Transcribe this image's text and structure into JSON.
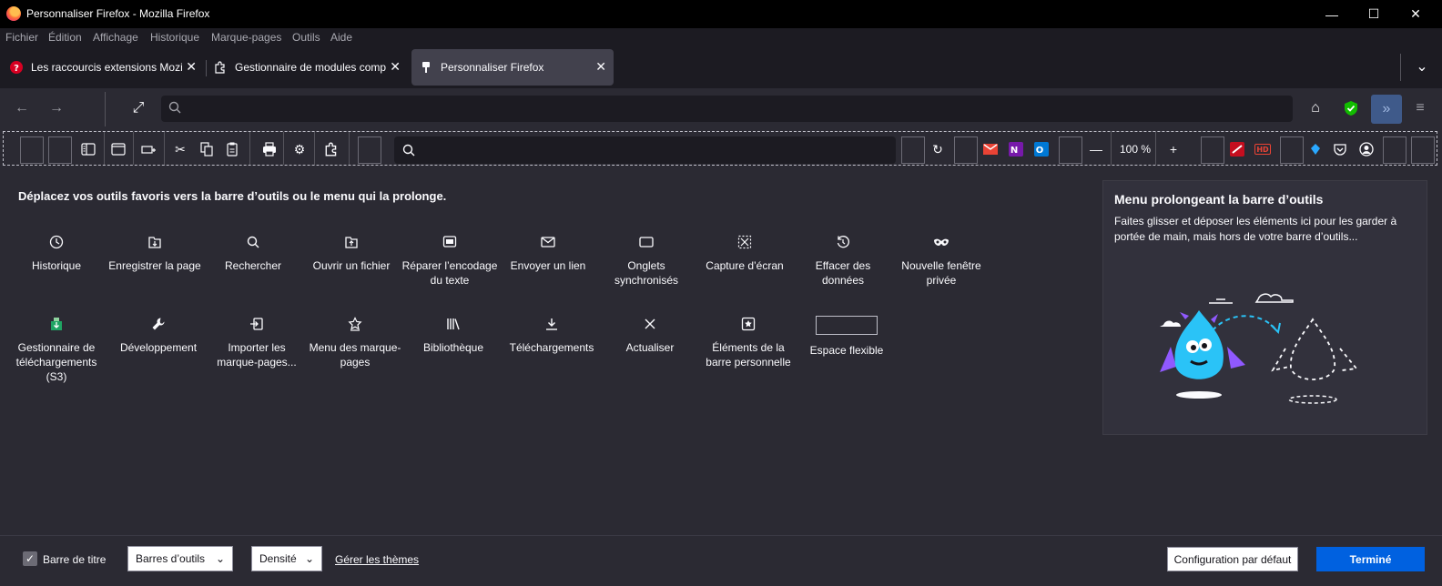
{
  "window": {
    "title": "Personnaliser Firefox - Mozilla Firefox"
  },
  "menubar": [
    "Fichier",
    "Édition",
    "Affichage",
    "Historique",
    "Marque-pages",
    "Outils",
    "Aide"
  ],
  "tabs": [
    {
      "label": "Les raccourcis extensions Mozilla",
      "active": false
    },
    {
      "label": "Gestionnaire de modules complémentaires",
      "active": false
    },
    {
      "label": "Personnaliser Firefox",
      "active": true
    }
  ],
  "custom_toolbar": {
    "zoom": "100 %"
  },
  "instruction": "Déplacez vos outils favoris vers la barre d’outils ou le menu qui la prolonge.",
  "palette_row1": [
    {
      "label": "Historique",
      "icon": "history-icon"
    },
    {
      "label": "Enregistrer la page",
      "icon": "save-page-icon"
    },
    {
      "label": "Rechercher",
      "icon": "search-icon"
    },
    {
      "label": "Ouvrir un fichier",
      "icon": "open-file-icon"
    },
    {
      "label": "Réparer l’encodage du texte",
      "icon": "text-encoding-icon"
    },
    {
      "label": "Envoyer un lien",
      "icon": "email-link-icon"
    },
    {
      "label": "Onglets synchronisés",
      "icon": "synced-tabs-icon"
    },
    {
      "label": "Capture d’écran",
      "icon": "screenshot-icon"
    },
    {
      "label": "Effacer des données",
      "icon": "forget-icon"
    },
    {
      "label": "Nouvelle fenêtre privée",
      "icon": "private-window-icon"
    }
  ],
  "palette_row2": [
    {
      "label": "Gestionnaire de téléchargements (S3)",
      "icon": "s3-download-icon"
    },
    {
      "label": "Développement",
      "icon": "wrench-icon"
    },
    {
      "label": "Importer les marque-pages...",
      "icon": "import-icon"
    },
    {
      "label": "Menu des marque-pages",
      "icon": "bookmarks-menu-icon"
    },
    {
      "label": "Bibliothèque",
      "icon": "library-icon"
    },
    {
      "label": "Téléchargements",
      "icon": "downloads-icon"
    },
    {
      "label": "Actualiser",
      "icon": "close-icon"
    },
    {
      "label": "Éléments de la barre personnelle",
      "icon": "personal-bookmarks-icon"
    },
    {
      "label": "Espace flexible",
      "icon": "flexible-space-icon"
    }
  ],
  "overflow_panel": {
    "title": "Menu prolongeant la barre d’outils",
    "description": "Faites glisser et déposer les éléments ici pour les garder à portée de main, mais hors de votre barre d’outils..."
  },
  "footer": {
    "titlebar_label": "Barre de titre",
    "toolbars_label": "Barres d’outils",
    "density_label": "Densité",
    "themes_link": "Gérer les thèmes",
    "default_button": "Configuration par défaut",
    "done_button": "Terminé"
  }
}
